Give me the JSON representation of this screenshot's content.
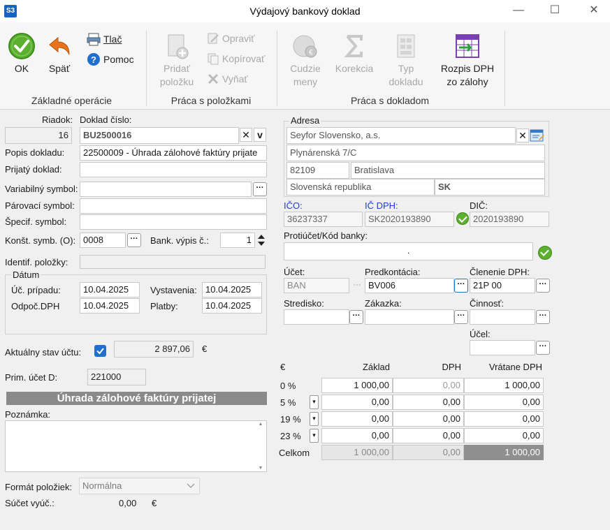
{
  "window": {
    "app_badge": "S3",
    "title": "Výdajový bankový doklad",
    "minimize": "—",
    "maximize": "☐",
    "close": "✕"
  },
  "ribbon": {
    "ok": "OK",
    "back": "Späť",
    "print": "Tlač",
    "help": "Pomoc",
    "group_basic": "Základné operácie",
    "add_item": [
      "Pridať",
      "položku"
    ],
    "edit": "Opraviť",
    "copy": "Kopírovať",
    "cut": "Vyňať",
    "group_items": "Práca s položkami",
    "foreign_currency": [
      "Cudzie",
      "meny"
    ],
    "correction": "Korekcia",
    "doc_type": [
      "Typ",
      "dokladu"
    ],
    "vat_breakdown": [
      "Rozpis DPH",
      "zo zálohy"
    ],
    "group_document": "Práca s dokladom"
  },
  "form": {
    "row_label": "Riadok:",
    "row_value": "16",
    "doc_number_label": "Doklad číslo:",
    "doc_number_value": "BU2500016",
    "description_label": "Popis dokladu:",
    "description_value": "22500009 - Úhrada zálohové faktúry prijate",
    "received_doc_label": "Prijatý doklad:",
    "received_doc_value": "",
    "variable_symbol_label": "Variabilný symbol:",
    "variable_symbol_value": "",
    "pairing_symbol_label": "Párovací symbol:",
    "pairing_symbol_value": "",
    "specific_symbol_label": "Špecif. symbol:",
    "specific_symbol_value": "",
    "constant_symbol_label": "Konšt. symb. (O):",
    "constant_symbol_value": "0008",
    "bank_statement_label": "Bank. výpis č.:",
    "bank_statement_value": "1",
    "item_ident_label": "Identif. položky:",
    "item_ident_value": "",
    "dates_legend": "Dátum",
    "case_date_label": "Úč. prípadu:",
    "case_date_value": "10.04.2025",
    "issue_date_label": "Vystavenia:",
    "issue_date_value": "10.04.2025",
    "vat_deduct_label": "Odpoč.DPH",
    "vat_deduct_value": "10.04.2025",
    "payment_date_label": "Platby:",
    "payment_date_value": "10.04.2025",
    "account_balance_label": "Aktuálny stav účtu:",
    "account_balance_value": "2 897,06",
    "currency_symbol": "€",
    "primary_account_label": "Prim. účet D:",
    "primary_account_value": "221000",
    "banner_text": "Úhrada zálohové faktúry prijatej",
    "note_label": "Poznámka:",
    "note_value": "",
    "item_format_label": "Formát položiek:",
    "item_format_value": "Normálna",
    "calc_sum_label": "Súčet vyúč.:",
    "calc_sum_value": "0,00",
    "calc_sum_currency": "€"
  },
  "address": {
    "legend": "Adresa",
    "name": "Seyfor Slovensko, a.s.",
    "street": "Plynárenská 7/C",
    "zip": "82109",
    "city": "Bratislava",
    "country": "Slovenská republika",
    "country_code": "SK",
    "ico_label": "IČO:",
    "ico_value": "36237337",
    "icdph_label": "IČ DPH:",
    "icdph_value": "SK2020193890",
    "dic_label": "DIČ:",
    "dic_value": "2020193890",
    "counter_account_label": "Protiúčet/Kód banky:",
    "counter_account_value": ".",
    "account_label": "Účet:",
    "account_value": "BAN",
    "precontation_label": "Predkontácia:",
    "precontation_value": "BV006",
    "vat_split_label": "Členenie DPH:",
    "vat_split_value": "21P 00",
    "center_label": "Stredisko:",
    "center_value": "",
    "order_label": "Zákazka:",
    "order_value": "",
    "activity_label": "Činnosť:",
    "activity_value": "",
    "purpose_label": "Účel:",
    "purpose_value": ""
  },
  "vat_table": {
    "currency_header": "€",
    "headers": [
      "Základ",
      "DPH",
      "Vrátane DPH"
    ],
    "rows": [
      {
        "rate": "0 %",
        "base": "1 000,00",
        "vat": "0,00",
        "total": "1 000,00"
      },
      {
        "rate": "5 %",
        "base": "0,00",
        "vat": "0,00",
        "total": "0,00"
      },
      {
        "rate": "19 %",
        "base": "0,00",
        "vat": "0,00",
        "total": "0,00"
      },
      {
        "rate": "23 %",
        "base": "0,00",
        "vat": "0,00",
        "total": "0,00"
      }
    ],
    "total_label": "Celkom",
    "total_base": "1 000,00",
    "total_vat": "0,00",
    "total_total": "1 000,00"
  },
  "colors": {
    "ok_green": "#5cb030",
    "back_orange": "#e8731a",
    "label_blue": "#1a3fd1",
    "banner_gray": "#8a8a8a",
    "checkbox_blue": "#1e6fd0"
  }
}
